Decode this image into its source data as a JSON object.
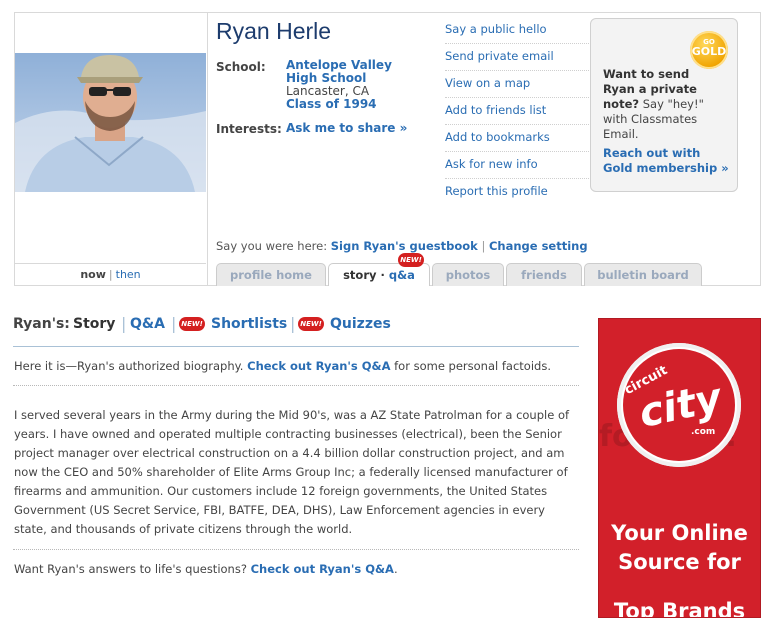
{
  "profile": {
    "name": "Ryan Herle",
    "school_label": "School:",
    "school_name_1": "Antelope Valley",
    "school_name_2": "High School",
    "school_location": "Lancaster, CA",
    "class_year": "Class of 1994",
    "interests_label": "Interests:",
    "interests_link": "Ask me to share »",
    "now_label": "now",
    "then_label": "then"
  },
  "actions": [
    "Say a public hello",
    "Send private email",
    "View on a map",
    "Add to friends list",
    "Add to bookmarks",
    "Ask for new info",
    "Report this profile"
  ],
  "gold": {
    "badge_top": "GO",
    "badge_main": "GOLD",
    "line1": "Want to send",
    "line2": "Ryan a private",
    "line3": "note?",
    "line3_rest": " Say \"hey!\"",
    "line4": "with Classmates",
    "line5": "Email.",
    "cta1": "Reach out with",
    "cta2": "Gold membership »"
  },
  "guestbook": {
    "prefix": "Say you were here:",
    "sign": "Sign Ryan's guestbook",
    "change": "Change setting"
  },
  "tabs": [
    {
      "label": "profile home"
    },
    {
      "label_a": "story · ",
      "label_b": "q&a"
    },
    {
      "label": "photos"
    },
    {
      "label": "friends"
    },
    {
      "label": "bulletin board"
    }
  ],
  "new_badge": "NEW!",
  "section": {
    "who": "Ryan's:",
    "story": "Story",
    "qa": "Q&A",
    "shortlists": "Shortlists",
    "quizzes": "Quizzes"
  },
  "intro": {
    "text": "Here it is—Ryan's authorized biography. ",
    "link": "Check out Ryan's Q&A",
    "rest": " for some personal factoids."
  },
  "bio": "I served several years in the Army during the Mid 90's, was a AZ State Patrolman for a couple of years. I have owned and operated multiple contracting businesses (electrical), been the Senior project manager over electrical construction on a 4.4 billion dollar construction project, and am now the CEO and 50% shareholder of Elite Arms Group Inc; a federally licensed manufacturer of firearms and ammunition. Our customers include 12 foreign governments, the United States Government (US Secret Service, FBI, BATFE, DEA, DHS), Law Enforcement agencies in every state, and thousands of private citizens through the world.",
  "footer": {
    "text": "Want Ryan's answers to life's questions? ",
    "link": "Check out Ryan's Q&A",
    "end": "."
  },
  "ad": {
    "ghost": "for less!",
    "logo_top": "circuit",
    "logo_main": "city",
    "logo_dot": ".com",
    "line1": "Your Online",
    "line2": "Source for",
    "line3": "Top Brands"
  },
  "colors": {
    "link": "#2a6db3",
    "name": "#1d3c6d",
    "ad_red": "#d2202a",
    "gold": "#f0a300"
  }
}
